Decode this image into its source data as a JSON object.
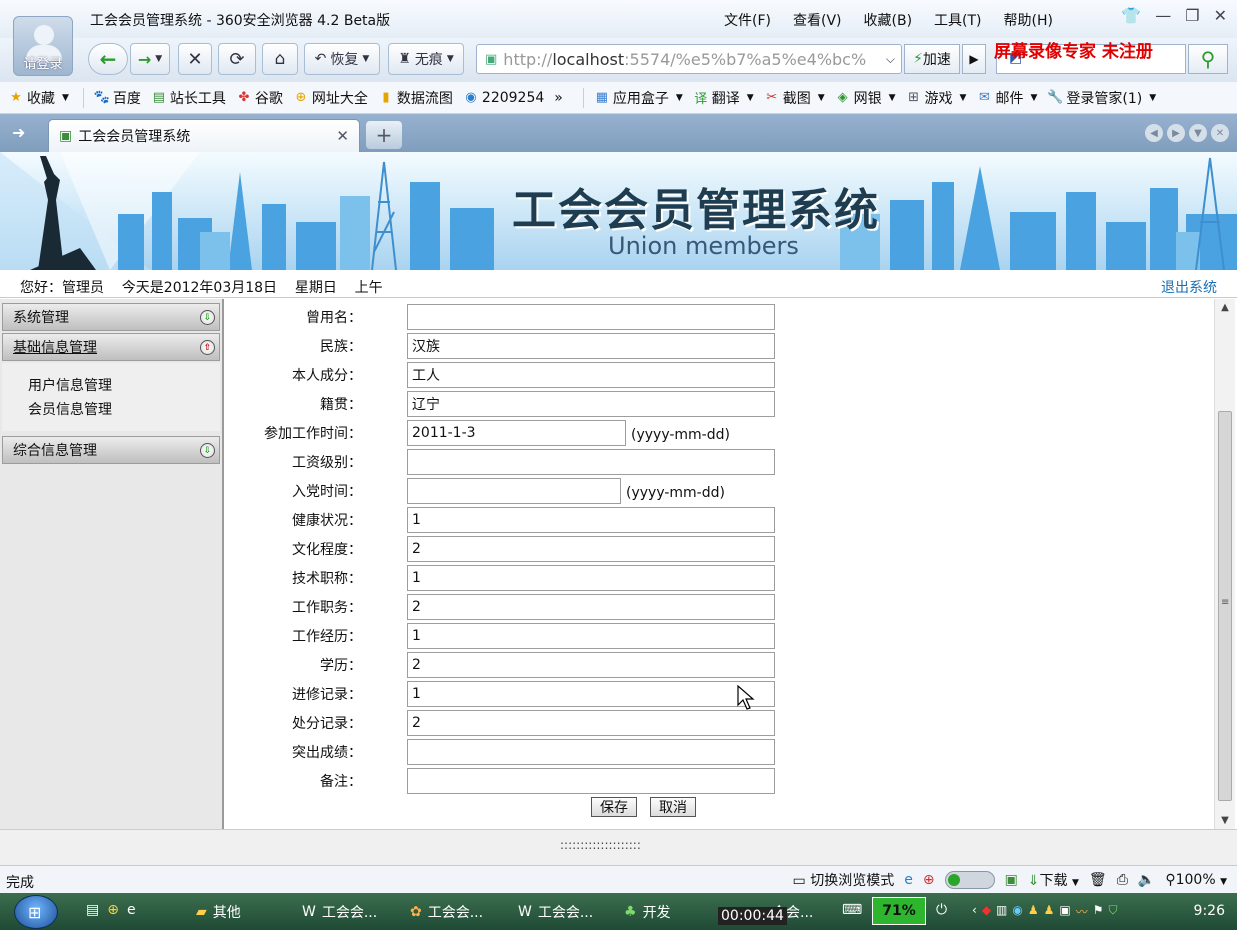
{
  "browser": {
    "window_title": "工会会员管理系统 - 360安全浏览器 4.2 Beta版",
    "login_label": "请登录",
    "menus": [
      "文件(F)",
      "查看(V)",
      "收藏(B)",
      "工具(T)",
      "帮助(H)"
    ],
    "restore_label": "恢复",
    "incognito_label": "无痕",
    "url_prefix": "http://",
    "url_host": "localhost",
    "url_rest": ":5574/%e5%b7%a5%e4%bc%",
    "accelerate_label": "加速",
    "watermark": "屏幕录像专家  未注册",
    "bookmarks": [
      "收藏",
      "百度",
      "站长工具",
      "谷歌",
      "网址大全",
      "数据流图",
      "2209254"
    ],
    "bookmarks_more": "»",
    "tools": [
      "应用盒子",
      "翻译",
      "截图",
      "网银",
      "游戏",
      "邮件",
      "登录管家(1)"
    ],
    "tab_title": "工会会员管理系统"
  },
  "app": {
    "banner_title": "工会会员管理系统",
    "banner_subtitle": "Union members",
    "greeting": "您好：管理员    今天是2012年03月18日    星期日    上午",
    "logout": "退出系统",
    "sidebar": {
      "sections": [
        "系统管理",
        "基础信息管理",
        "综合信息管理"
      ],
      "links": [
        "用户信息管理",
        "会员信息管理"
      ]
    },
    "form": {
      "fields": [
        {
          "label": "曾用名：",
          "value": ""
        },
        {
          "label": "民族：",
          "value": "汉族"
        },
        {
          "label": "本人成分：",
          "value": "工人"
        },
        {
          "label": "籍贯：",
          "value": "辽宁"
        },
        {
          "label": "参加工作时间：",
          "value": "2011-1-3",
          "hint": "(yyyy-mm-dd)"
        },
        {
          "label": "工资级别：",
          "value": ""
        },
        {
          "label": "入党时间：",
          "value": "",
          "hint": "(yyyy-mm-dd)"
        },
        {
          "label": "健康状况：",
          "value": "1"
        },
        {
          "label": "文化程度：",
          "value": "2"
        },
        {
          "label": "技术职称：",
          "value": "1"
        },
        {
          "label": "工作职务：",
          "value": "2"
        },
        {
          "label": "工作经历：",
          "value": "1"
        },
        {
          "label": "学历：",
          "value": "2"
        },
        {
          "label": "进修记录：",
          "value": "1"
        },
        {
          "label": "处分记录：",
          "value": "2"
        },
        {
          "label": "突出成绩：",
          "value": ""
        },
        {
          "label": "备注：",
          "value": ""
        }
      ],
      "save": "保存",
      "cancel": "取消"
    },
    "bottom_dots": "::::::::::::::::::::"
  },
  "status": {
    "left": "完成",
    "switch_mode": "切换浏览模式",
    "download": "下载",
    "zoom": "100%"
  },
  "taskbar": {
    "items": [
      "其他",
      "工会会...",
      "工会会...",
      "工会会...",
      "开发",
      "会会..."
    ],
    "timer": "00:00:44",
    "battery": "71%",
    "clock": "9:26"
  }
}
